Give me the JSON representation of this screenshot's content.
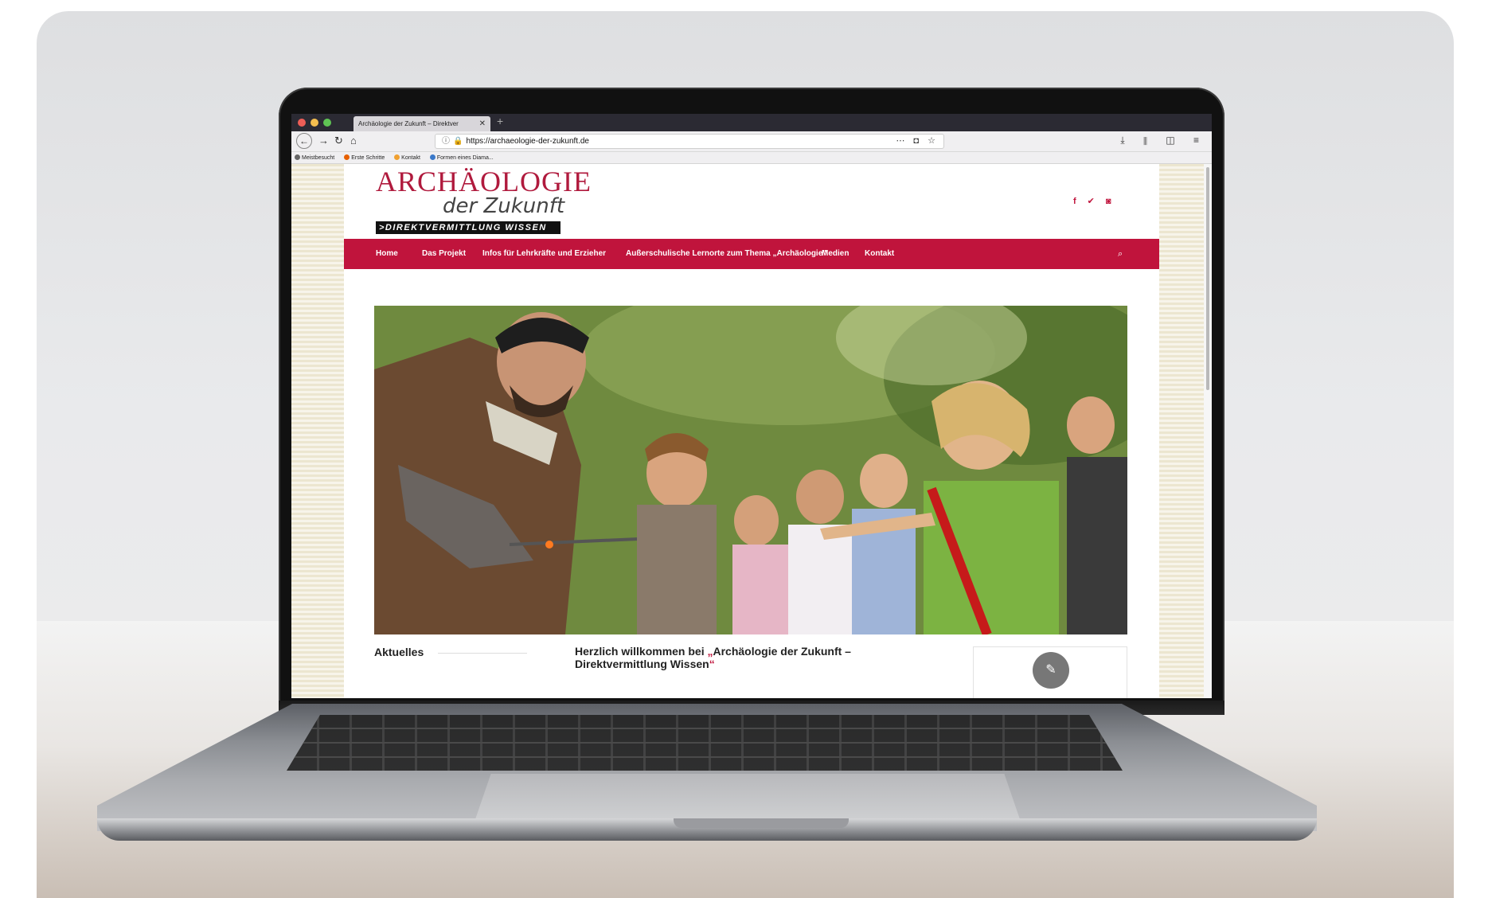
{
  "browser": {
    "tab_title": "Archäologie der Zukunft – Direktver",
    "tab_close": "✕",
    "new_tab": "+",
    "url": "https://archaeologie-der-zukunft.de",
    "url_actions": "⋯ ◘ ☆",
    "toolbar_icons": "⤓ ⫴ ◫ ≡",
    "nav": {
      "back": "←",
      "forward": "→",
      "reload": "↻",
      "home": "⌂"
    },
    "bookmarks": [
      {
        "label": "Meistbesucht",
        "icon": "gear-icon",
        "color": "#666666"
      },
      {
        "label": "Erste Schritte",
        "icon": "firefox-icon",
        "color": "#e66000"
      },
      {
        "label": "Kontakt",
        "icon": "contact-icon",
        "color": "#f0a030"
      },
      {
        "label": "Formen eines Diama...",
        "icon": "globe-icon",
        "color": "#3a78c9"
      }
    ]
  },
  "site": {
    "logo_title": "ARCHÄOLOGIE",
    "logo_subtitle": "der Zukunft",
    "logo_tagline": ">DIREKTVERMITTLUNG WISSEN",
    "social": [
      "f",
      "✔",
      "◙"
    ],
    "menu": [
      "Home",
      "Das Projekt",
      "Infos für Lehrkräfte und Erzieher",
      "Außerschulische Lernorte zum Thema „Archäologie\"",
      "Medien",
      "Kontakt"
    ],
    "search_icon": "⌕",
    "aktuelles_heading": "Aktuelles",
    "welcome_text_1": "Herzlich willkommen bei ",
    "welcome_quote_open": "„",
    "welcome_text_2": "Archäologie der Zukunft –",
    "welcome_text_3": "Direktvermittlung Wissen",
    "welcome_quote_close": "“",
    "widget_icon": "✎"
  },
  "colors": {
    "brand_red": "#c0143c",
    "logo_red": "#b01a3d"
  }
}
